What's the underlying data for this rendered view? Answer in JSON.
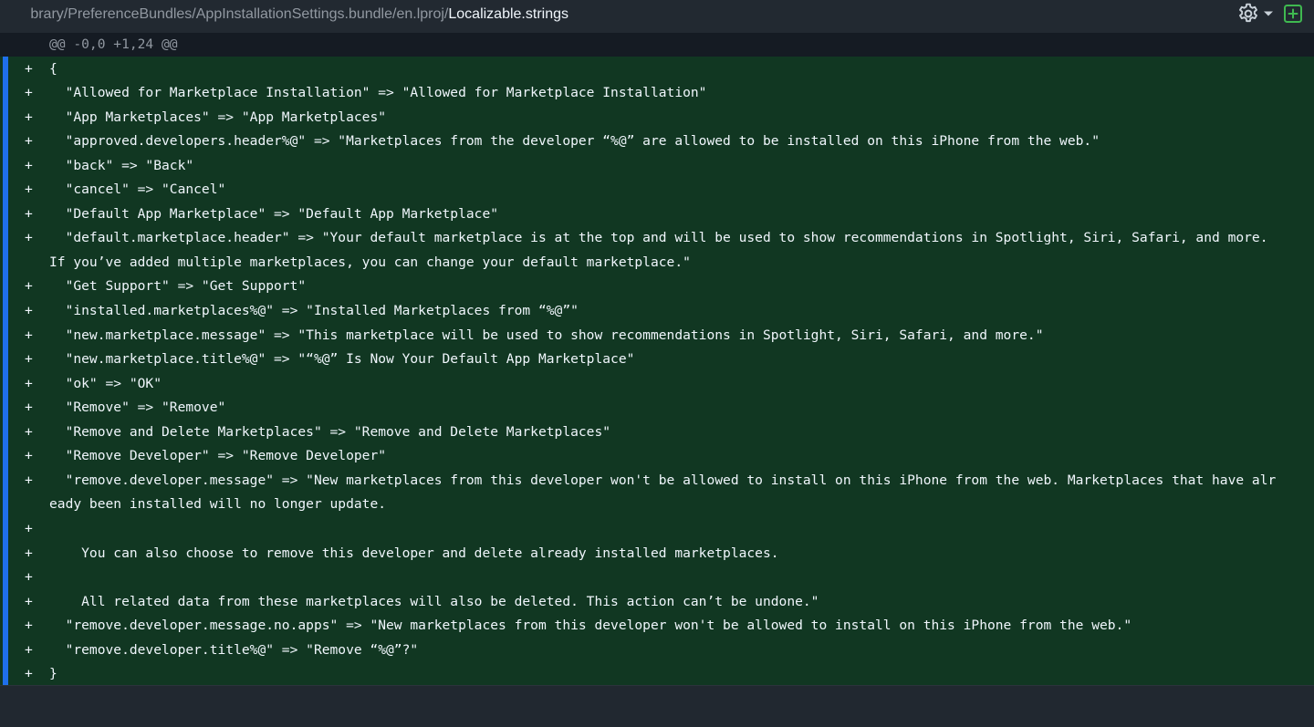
{
  "header": {
    "path_prefix": "brary/PreferenceBundles/AppInstallationSettings.bundle/en.lproj/",
    "file_name": "Localizable.strings",
    "settings_icon": "gear-icon",
    "dropdown_icon": "caret-down-icon",
    "add_icon": "plus-square-icon"
  },
  "colors": {
    "addition_background": "#113722",
    "addition_bar": "#1f6feb",
    "hunk_background": "#151b23",
    "add_icon_color": "#3fb950"
  },
  "diff": {
    "hunk_header": "@@ -0,0 +1,24 @@",
    "marker": "+",
    "lines": [
      "{",
      "  \"Allowed for Marketplace Installation\" => \"Allowed for Marketplace Installation\"",
      "  \"App Marketplaces\" => \"App Marketplaces\"",
      "  \"approved.developers.header%@\" => \"Marketplaces from the developer “%@” are allowed to be installed on this iPhone from the web.\"",
      "  \"back\" => \"Back\"",
      "  \"cancel\" => \"Cancel\"",
      "  \"Default App Marketplace\" => \"Default App Marketplace\"",
      "  \"default.marketplace.header\" => \"Your default marketplace is at the top and will be used to show recommendations in Spotlight, Siri, Safari, and more.",
      "If you’ve added multiple marketplaces, you can change your default marketplace.\"",
      "  \"Get Support\" => \"Get Support\"",
      "  \"installed.marketplaces%@\" => \"Installed Marketplaces from “%@”\"",
      "  \"new.marketplace.message\" => \"This marketplace will be used to show recommendations in Spotlight, Siri, Safari, and more.\"",
      "  \"new.marketplace.title%@\" => \"“%@” Is Now Your Default App Marketplace\"",
      "  \"ok\" => \"OK\"",
      "  \"Remove\" => \"Remove\"",
      "  \"Remove and Delete Marketplaces\" => \"Remove and Delete Marketplaces\"",
      "  \"Remove Developer\" => \"Remove Developer\"",
      "  \"remove.developer.message\" => \"New marketplaces from this developer won't be allowed to install on this iPhone from the web. Marketplaces that have alr",
      "eady been installed will no longer update.",
      "",
      "    You can also choose to remove this developer and delete already installed marketplaces.",
      "",
      "    All related data from these marketplaces will also be deleted. This action can’t be undone.\"",
      "  \"remove.developer.message.no.apps\" => \"New marketplaces from this developer won't be allowed to install on this iPhone from the web.\"",
      "  \"remove.developer.title%@\" => \"Remove “%@”?\"",
      "}"
    ],
    "line_markers": [
      "+",
      "+",
      "+",
      "+",
      "+",
      "+",
      "+",
      "+",
      "",
      "+",
      "+",
      "+",
      "+",
      "+",
      "+",
      "+",
      "+",
      "+",
      "",
      "+",
      "+",
      "+",
      "+",
      "+",
      "+",
      "+"
    ]
  }
}
